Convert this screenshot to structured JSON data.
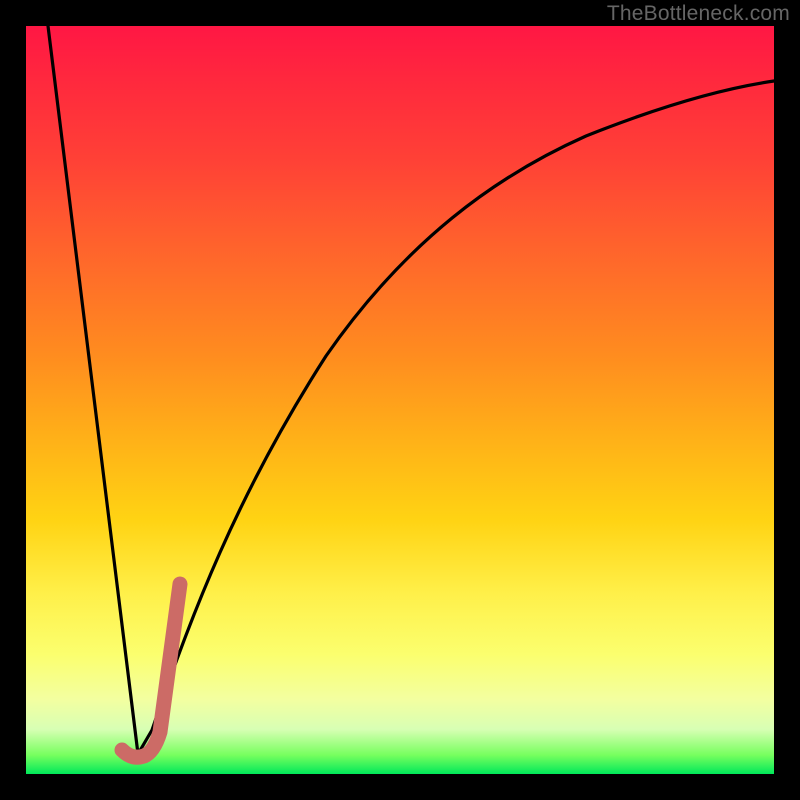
{
  "watermark": "TheBottleneck.com",
  "colors": {
    "frame": "#000000",
    "curve": "#000000",
    "accent_stroke": "#cc6b66",
    "gradient_stops": [
      "#ff1744",
      "#ff4136",
      "#ff8c1f",
      "#ffd313",
      "#fbff6e",
      "#00e85a"
    ]
  },
  "chart_data": {
    "type": "line",
    "title": "",
    "xlabel": "",
    "ylabel": "",
    "xlim": [
      0,
      100
    ],
    "ylim": [
      0,
      100
    ],
    "series": [
      {
        "name": "bottleneck-curve",
        "x": [
          0,
          2,
          4,
          6,
          8,
          10,
          12,
          14,
          15,
          16,
          18,
          20,
          22,
          25,
          30,
          35,
          40,
          50,
          60,
          70,
          80,
          90,
          100
        ],
        "y": [
          100,
          87,
          73,
          60,
          47,
          33,
          20,
          7,
          0,
          5,
          16,
          26,
          35,
          46,
          59,
          68,
          74,
          82,
          86,
          89,
          91,
          92.5,
          93.5
        ]
      }
    ],
    "accent_marker": {
      "name": "selected-region-J",
      "x": [
        12.5,
        14.0,
        15.0,
        16.0,
        17.0,
        18.0,
        19.0,
        20.0
      ],
      "y": [
        2.0,
        1.5,
        1.5,
        3.0,
        8.0,
        13.0,
        19.0,
        25.0
      ]
    }
  }
}
